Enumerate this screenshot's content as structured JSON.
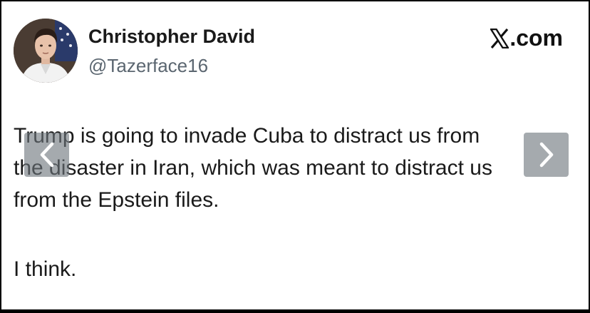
{
  "author": {
    "display_name": "Christopher David",
    "handle": "@Tazerface16",
    "avatar_icon": "profile-photo"
  },
  "brand": {
    "logo_icon": "x-logo-icon",
    "suffix": ".com"
  },
  "tweet": {
    "lines": [
      "Trump is going to invade Cuba to distract us from",
      "the disaster in Iran, which was meant to distract us",
      "from the Epstein files."
    ],
    "closing": "I think."
  },
  "carousel": {
    "prev_icon": "chevron-left-icon",
    "next_icon": "chevron-right-icon"
  },
  "colors": {
    "background": "#ffffff",
    "text": "#1a1a1a",
    "handle": "#5b6670",
    "frame": "#000000",
    "overlay": "#6e767c"
  }
}
